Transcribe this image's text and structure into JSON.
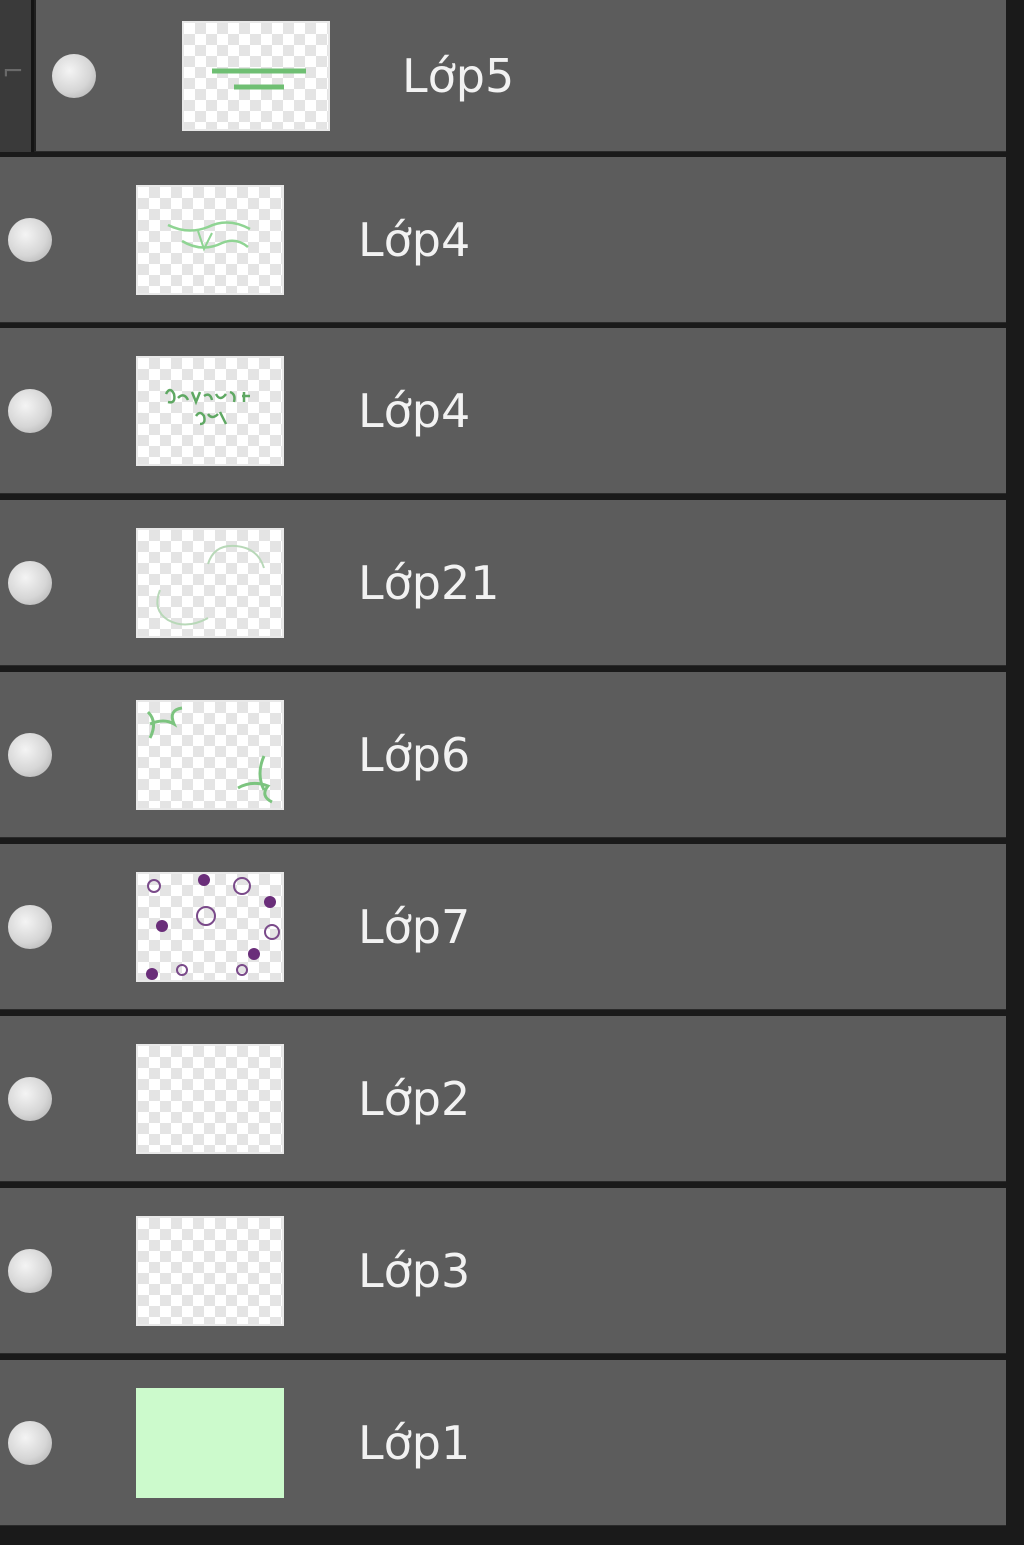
{
  "layers_panel": {
    "layers": [
      {
        "name": "Lớp5",
        "thumbnail": "horizontal-lines-green",
        "nested": true
      },
      {
        "name": "Lớp4",
        "thumbnail": "green-text-sketch",
        "nested": false
      },
      {
        "name": "Lớp4",
        "thumbnail": "green-text-handwriting",
        "nested": false
      },
      {
        "name": "Lớp21",
        "thumbnail": "green-curves",
        "nested": false
      },
      {
        "name": "Lớp6",
        "thumbnail": "green-corner-ornaments",
        "nested": false
      },
      {
        "name": "Lớp7",
        "thumbnail": "purple-dots-circles",
        "nested": false
      },
      {
        "name": "Lớp2",
        "thumbnail": "empty-transparent",
        "nested": false
      },
      {
        "name": "Lớp3",
        "thumbnail": "empty-transparent",
        "nested": false
      },
      {
        "name": "Lớp1",
        "thumbnail": "solid-light-green",
        "fill_color": "#ccfacc",
        "nested": false
      }
    ],
    "colors": {
      "row_background": "#5c5c5c",
      "separator": "#1a1a1a",
      "text": "#f2f2f2",
      "stroke_green": "#6fbf73",
      "stroke_purple": "#6a2e7a"
    }
  }
}
